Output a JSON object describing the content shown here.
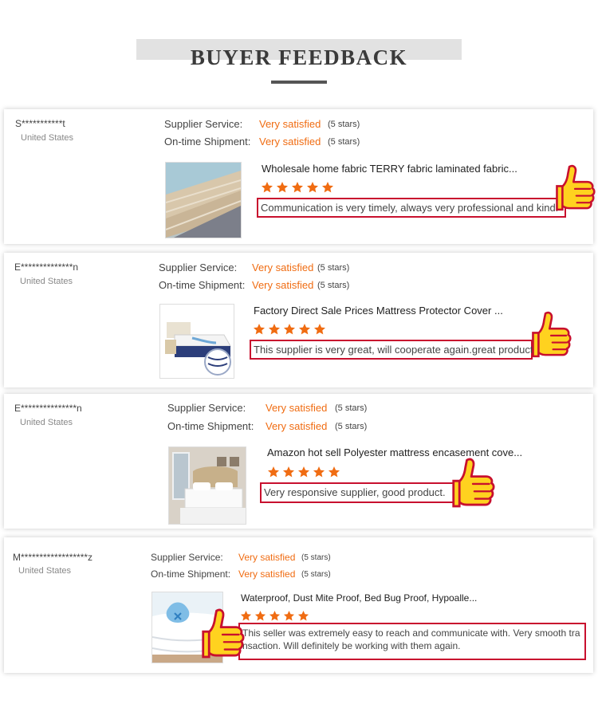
{
  "header": {
    "title": "BUYER FEEDBACK"
  },
  "labels": {
    "supplier_service": "Supplier Service:",
    "ontime_shipment": "On-time Shipment:"
  },
  "colors": {
    "accent": "#f06c12",
    "highlight_border": "#c8102e",
    "thumb_yellow": "#ffd21f"
  },
  "reviews": [
    {
      "buyer": "S***********t",
      "country": "United States",
      "supplier_service": "Very satisfied",
      "supplier_stars": "(5 stars)",
      "shipment": "Very satisfied",
      "shipment_stars": "(5 stars)",
      "product": "Wholesale home fabric TERRY fabric laminated fabric...",
      "rating": 5,
      "comment": "Communication is very timely, always very professional and kind."
    },
    {
      "buyer": "E**************n",
      "country": "United States",
      "supplier_service": "Very satisfied",
      "supplier_stars": "(5 stars)",
      "shipment": "Very satisfied",
      "shipment_stars": "(5 stars)",
      "product": "Factory Direct Sale Prices Mattress Protector Cover ...",
      "rating": 5,
      "comment": "This supplier is very great, will cooperate again.great products."
    },
    {
      "buyer": "E***************n",
      "country": "United States",
      "supplier_service": "Very satisfied",
      "supplier_stars": "(5 stars)",
      "shipment": "Very satisfied",
      "shipment_stars": "(5 stars)",
      "product": "Amazon hot sell Polyester mattress encasement cove...",
      "rating": 5,
      "comment": "Very responsive supplier, good product."
    },
    {
      "buyer": "M******************z",
      "country": "United States",
      "supplier_service": "Very satisfied",
      "supplier_stars": "(5 stars)",
      "shipment": "Very satisfied",
      "shipment_stars": "(5 stars)",
      "product": "Waterproof, Dust Mite Proof, Bed Bug Proof, Hypoalle...",
      "rating": 5,
      "comment": "This seller was extremely easy to reach and communicate with. Very smooth transaction. Will definitely be working with them again."
    }
  ]
}
